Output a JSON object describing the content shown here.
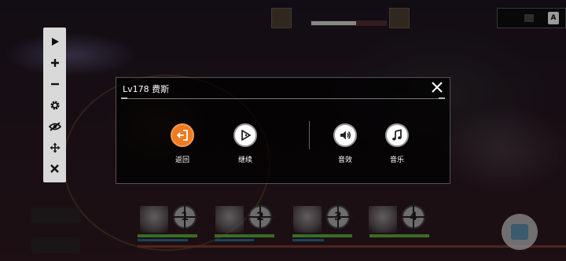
{
  "menu": {
    "title": "Lv178 费斯",
    "buttons": [
      {
        "key": "back",
        "label": "返回",
        "icon": "exit-icon"
      },
      {
        "key": "continue",
        "label": "继续",
        "icon": "play-icon"
      },
      {
        "key": "sound",
        "label": "音效",
        "icon": "speaker-icon"
      },
      {
        "key": "music",
        "label": "音乐",
        "icon": "music-note-icon"
      }
    ]
  },
  "toolbar": {
    "icons": [
      "play-icon",
      "plus-icon",
      "minus-icon",
      "gear-icon",
      "eye-off-icon",
      "move-icon",
      "close-icon"
    ]
  },
  "team": {
    "slots": [
      "1",
      "2",
      "3",
      "4"
    ]
  },
  "colors": {
    "accent": "#ef7a20",
    "toolbar_bg": "#d9d9d9",
    "panel_bg": "rgba(0,0,0,0.72)"
  }
}
